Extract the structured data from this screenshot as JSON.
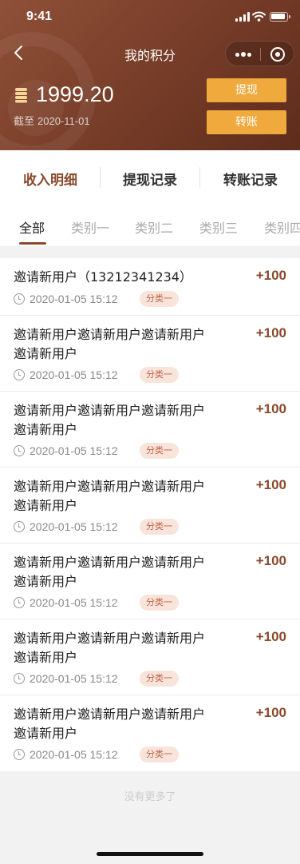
{
  "status_bar": {
    "time": "9:41"
  },
  "navbar": {
    "title": "我的积分"
  },
  "account": {
    "points": "1999.20",
    "as_of_label": "截至",
    "as_of_date": "2020-11-01",
    "withdraw_label": "提现",
    "transfer_label": "转账"
  },
  "tabs": [
    {
      "label": "收入明细",
      "active": true
    },
    {
      "label": "提现记录",
      "active": false
    },
    {
      "label": "转账记录",
      "active": false
    }
  ],
  "categories": [
    {
      "label": "全部",
      "active": true
    },
    {
      "label": "类别一",
      "active": false
    },
    {
      "label": "类别二",
      "active": false
    },
    {
      "label": "类别三",
      "active": false
    },
    {
      "label": "类别四",
      "active": false
    }
  ],
  "records": [
    {
      "title": "邀请新用户（13212341234）",
      "amount": "+100",
      "time": "2020-01-05 15:12",
      "tag": "分类一"
    },
    {
      "title": "邀请新用户邀请新用户邀请新用户邀请新用户",
      "amount": "+100",
      "time": "2020-01-05 15:12",
      "tag": "分类一"
    },
    {
      "title": "邀请新用户邀请新用户邀请新用户邀请新用户",
      "amount": "+100",
      "time": "2020-01-05 15:12",
      "tag": "分类一"
    },
    {
      "title": "邀请新用户邀请新用户邀请新用户邀请新用户",
      "amount": "+100",
      "time": "2020-01-05 15:12",
      "tag": "分类一"
    },
    {
      "title": "邀请新用户邀请新用户邀请新用户邀请新用户",
      "amount": "+100",
      "time": "2020-01-05 15:12",
      "tag": "分类一"
    },
    {
      "title": "邀请新用户邀请新用户邀请新用户邀请新用户",
      "amount": "+100",
      "time": "2020-01-05 15:12",
      "tag": "分类一"
    },
    {
      "title": "邀请新用户邀请新用户邀请新用户邀请新用户",
      "amount": "+100",
      "time": "2020-01-05 15:12",
      "tag": "分类一"
    }
  ],
  "footer": {
    "no_more": "没有更多了"
  },
  "colors": {
    "accent": "#8a4a2e",
    "button": "#f0a93d",
    "tag_bg": "#f9e4dc",
    "tag_text": "#c0603f"
  }
}
